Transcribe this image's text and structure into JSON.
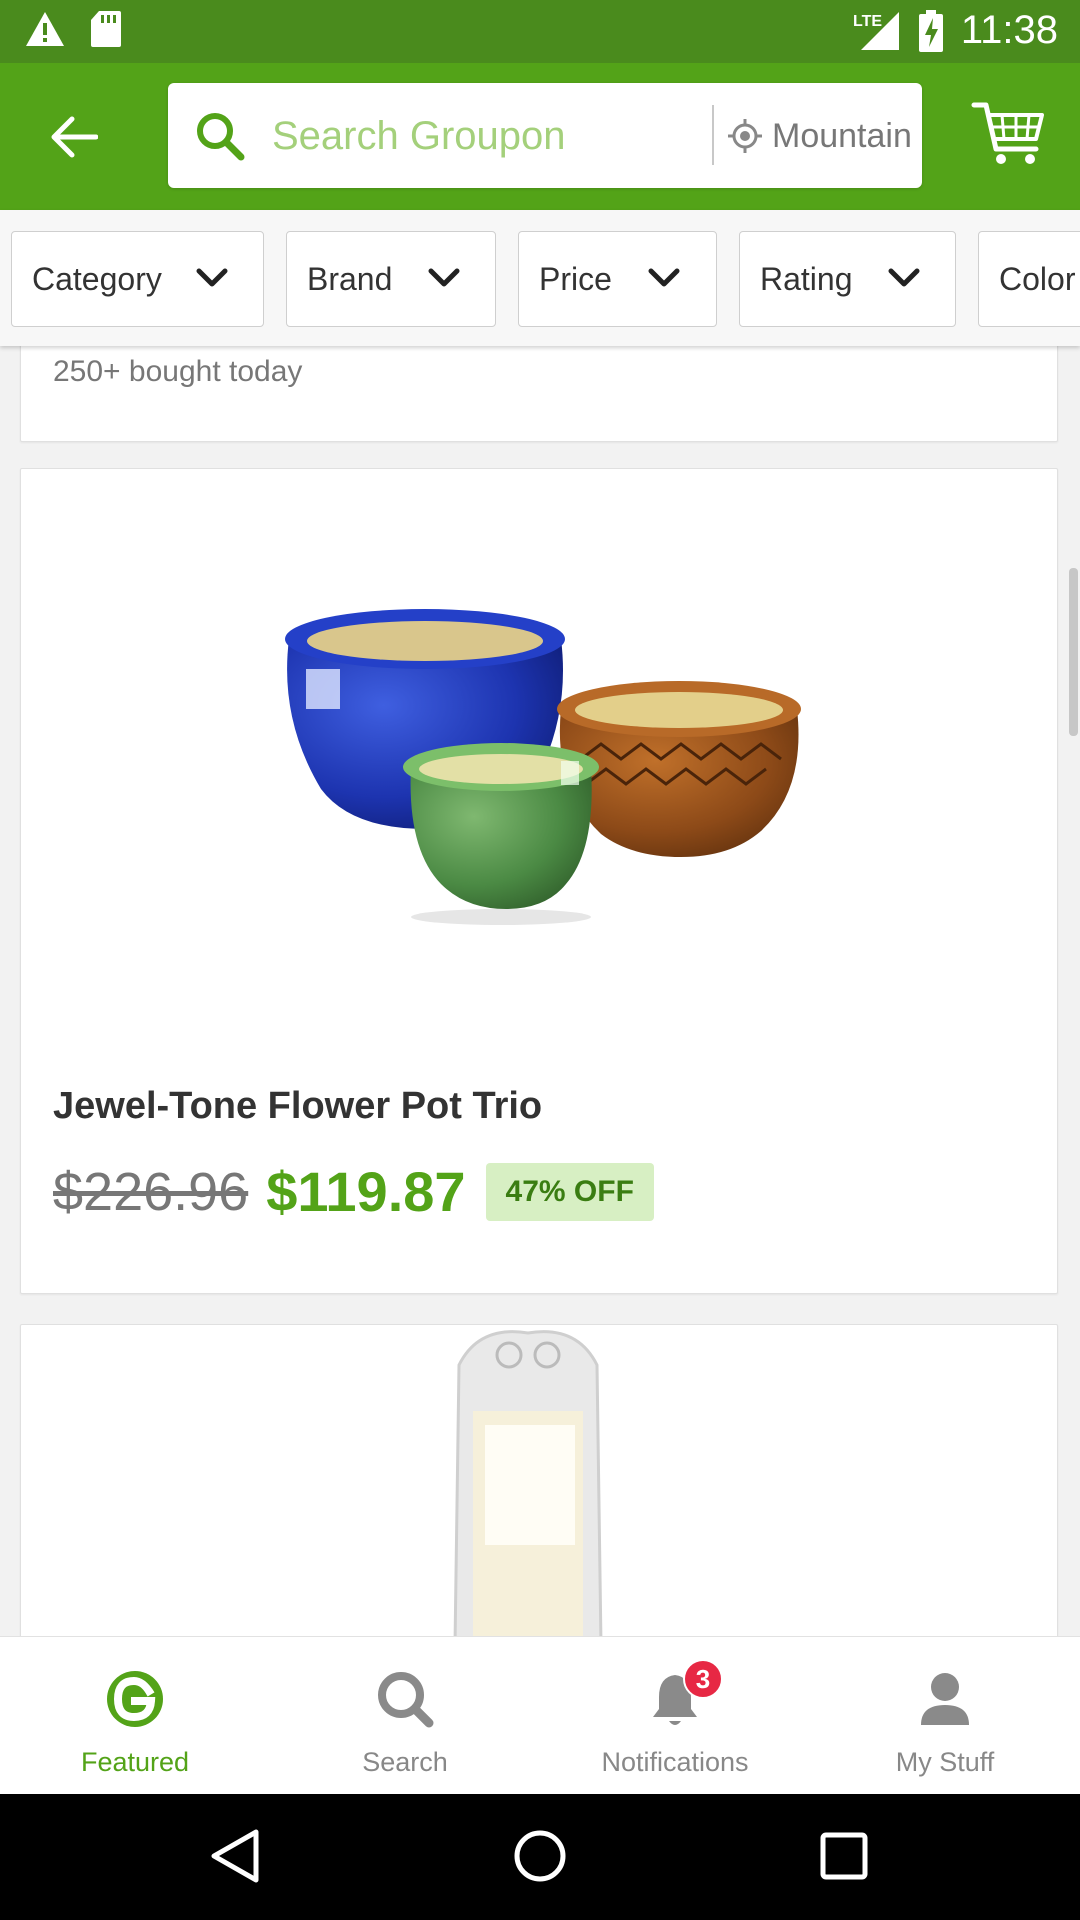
{
  "status_bar": {
    "time": "11:38",
    "network": "LTE",
    "icons": [
      "warning-icon",
      "sd-card-icon",
      "signal-icon",
      "battery-charging-icon"
    ]
  },
  "app_bar": {
    "search_placeholder": "Search Groupon",
    "location": "Mountain View",
    "brand_color": "#53a318"
  },
  "filters": [
    {
      "label": "Category"
    },
    {
      "label": "Brand"
    },
    {
      "label": "Price"
    },
    {
      "label": "Rating"
    },
    {
      "label": "Color"
    }
  ],
  "feed": {
    "previous_card": {
      "bought_text": "250+ bought today"
    },
    "product": {
      "title": "Jewel-Tone Flower Pot Trio",
      "original_price": "$226.96",
      "sale_price": "$119.87",
      "discount": "47% OFF"
    }
  },
  "bottom_nav": {
    "items": [
      {
        "label": "Featured",
        "icon": "groupon-g-icon",
        "active": true
      },
      {
        "label": "Search",
        "icon": "search-icon",
        "active": false
      },
      {
        "label": "Notifications",
        "icon": "bell-icon",
        "active": false,
        "badge": "3"
      },
      {
        "label": "My Stuff",
        "icon": "person-icon",
        "active": false
      }
    ]
  },
  "system_nav": [
    "back-triangle-icon",
    "home-circle-icon",
    "recents-square-icon"
  ]
}
